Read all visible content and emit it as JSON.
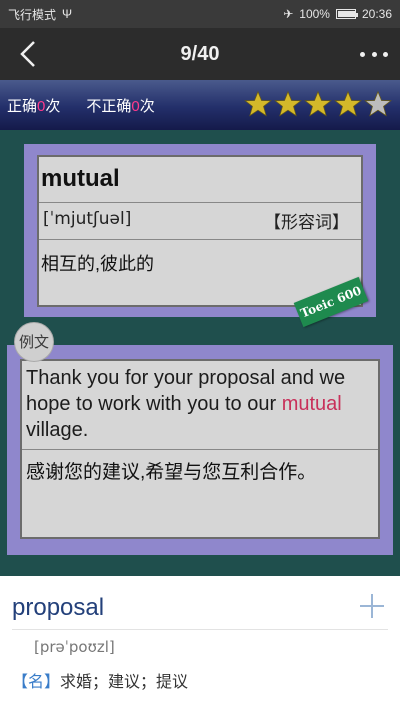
{
  "status_bar": {
    "carrier": "飞行模式",
    "usb_symbol": "Ψ",
    "airplane_symbol": "✈",
    "battery": "100%",
    "battery_level": 1.0,
    "time": "20:36"
  },
  "nav": {
    "title": "9/40",
    "back_icon": "chevron-left-icon",
    "more_icon": "more-dots-icon"
  },
  "score": {
    "correct_prefix": "正确",
    "correct_count": "0",
    "correct_suffix": "次",
    "incorrect_prefix": "不正确",
    "incorrect_count": "0",
    "incorrect_suffix": "次",
    "rating_filled": 4,
    "rating_max": 5,
    "colors": {
      "star_filled": "#d4b82a",
      "star_empty": "#bdbdbd",
      "count": "#ff3a8c"
    }
  },
  "word_card": {
    "word": "mutual",
    "phonetic": "[ˈmjutʃuəl]",
    "part_of_speech": "【形容词】",
    "meaning": "相互的,彼此的",
    "tag": "Toeic 600"
  },
  "example": {
    "badge": "例文",
    "sentence_before": "Thank you for your proposal and we hope to work with you to our ",
    "sentence_highlight": "mutual",
    "sentence_after": " village.",
    "translation": "感谢您的建议,希望与您互利合作。"
  },
  "dictionary": {
    "word": "proposal",
    "phonetic": "[prəˈpoʊzl]",
    "pos": "【名】",
    "definition": "求婚；建议；提议",
    "add_icon": "plus-icon"
  }
}
